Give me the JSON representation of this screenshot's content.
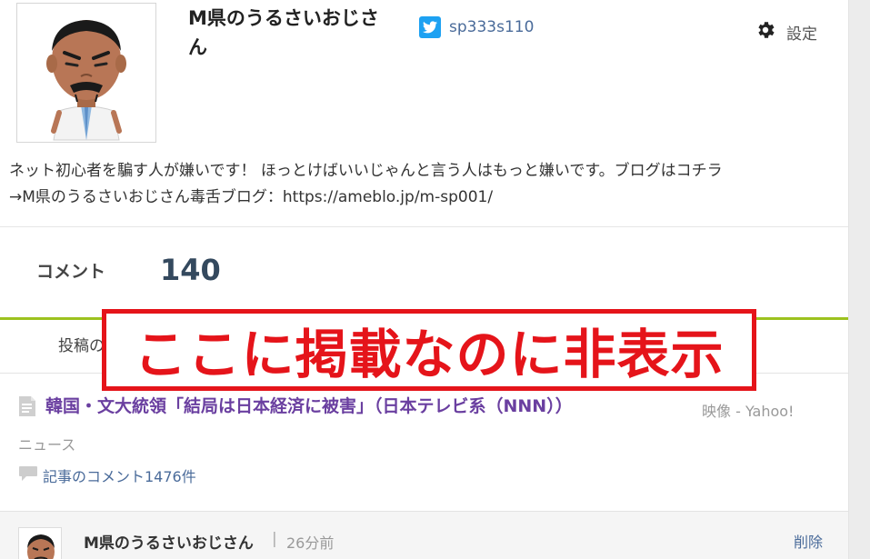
{
  "profile": {
    "name": "M県のうるさいおじさん",
    "twitter_handle": "sp333s110",
    "settings_label": "設定",
    "bio_line1": "ネット初心者を騙す人が嫌いです！ ほっとけばいいじゃんと言う人はもっと嫌いです。ブログはコチラ",
    "bio_line2": "→M県のうるさいおじさん毒舌ブログ：https://ameblo.jp/m-sp001/"
  },
  "stats": {
    "comment_label": "コメント",
    "comment_count": "140"
  },
  "tabs": {
    "posted_label": "投稿の"
  },
  "overlay": {
    "text": "ここに掲載なのに非表示",
    "color": "#e5141a"
  },
  "article": {
    "title": "韓国・文大統領「結局は日本経済に被害」（日本テレビ系（NNN））",
    "source_line1": "映像 - Yahoo!",
    "source_line2": "ニュース",
    "comments_link": "記事のコメント1476件"
  },
  "comment": {
    "author": "M県のうるさいおじさん",
    "separator": "|",
    "time": "26分前",
    "delete_label": "削除"
  },
  "colors": {
    "accent_green": "#9cc21e",
    "twitter": "#1da1f2",
    "link": "#4a6b9a",
    "article_title": "#6a3fa0"
  }
}
